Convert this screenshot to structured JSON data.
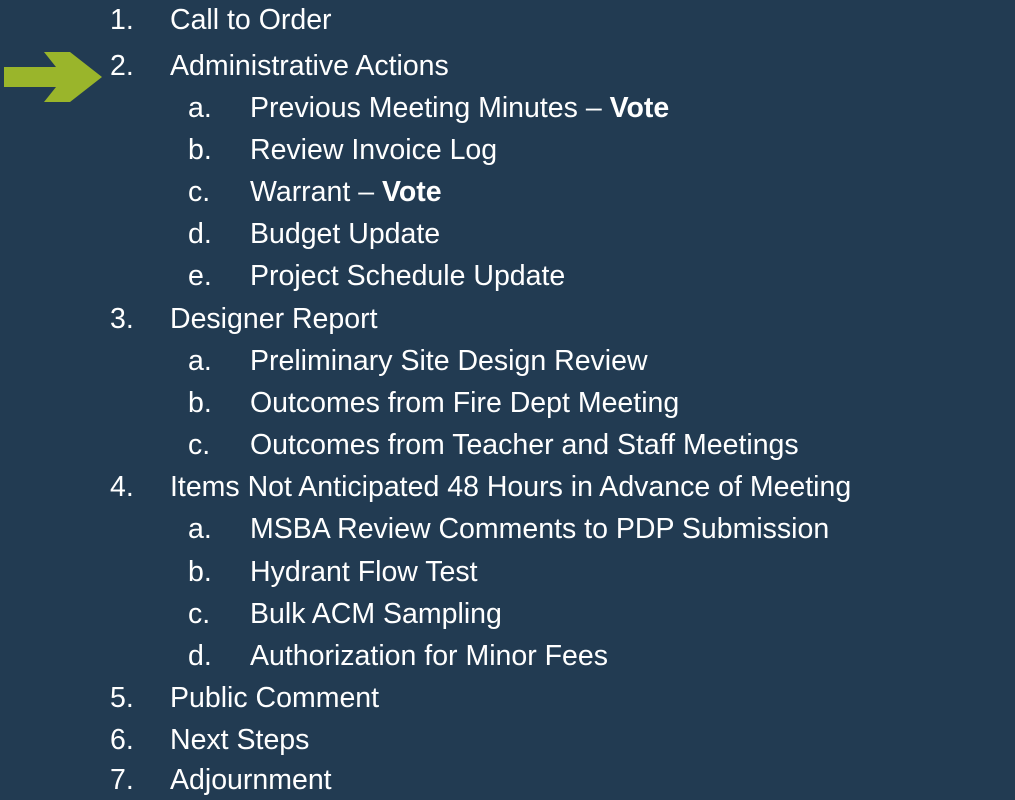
{
  "agenda": {
    "items": [
      {
        "num": "1.",
        "text": "Call to Order"
      },
      {
        "num": "2.",
        "text": "Administrative Actions",
        "current": true
      },
      {
        "num": "a.",
        "text": "Previous Meeting Minutes – ",
        "bold": "Vote",
        "sub": true
      },
      {
        "num": "b.",
        "text": "Review Invoice Log",
        "sub": true
      },
      {
        "num": "c.",
        "text": "Warrant – ",
        "bold": "Vote",
        "sub": true
      },
      {
        "num": "d.",
        "text": "Budget Update",
        "sub": true
      },
      {
        "num": "e.",
        "text": "Project Schedule Update",
        "sub": true
      },
      {
        "num": "3.",
        "text": "Designer Report"
      },
      {
        "num": "a.",
        "text": "Preliminary Site Design Review",
        "sub": true
      },
      {
        "num": "b.",
        "text": "Outcomes from Fire Dept Meeting",
        "sub": true
      },
      {
        "num": "c.",
        "text": "Outcomes from Teacher and Staff Meetings",
        "sub": true
      },
      {
        "num": "4.",
        "text": "Items Not Anticipated 48 Hours in Advance of Meeting"
      },
      {
        "num": "a.",
        "text": "MSBA Review Comments to PDP Submission",
        "sub": true
      },
      {
        "num": "b.",
        "text": "Hydrant Flow Test",
        "sub": true
      },
      {
        "num": "c.",
        "text": "Bulk ACM Sampling",
        "sub": true
      },
      {
        "num": "d.",
        "text": "Authorization for Minor Fees",
        "sub": true
      },
      {
        "num": "5.",
        "text": "Public Comment"
      },
      {
        "num": "6.",
        "text": "Next Steps"
      },
      {
        "num": "7.",
        "text": "Adjournment"
      }
    ]
  },
  "colors": {
    "background": "#223b52",
    "text": "#ffffff",
    "arrow": "#9ab52b"
  },
  "current_marker": {
    "icon": "arrow-right-icon"
  }
}
